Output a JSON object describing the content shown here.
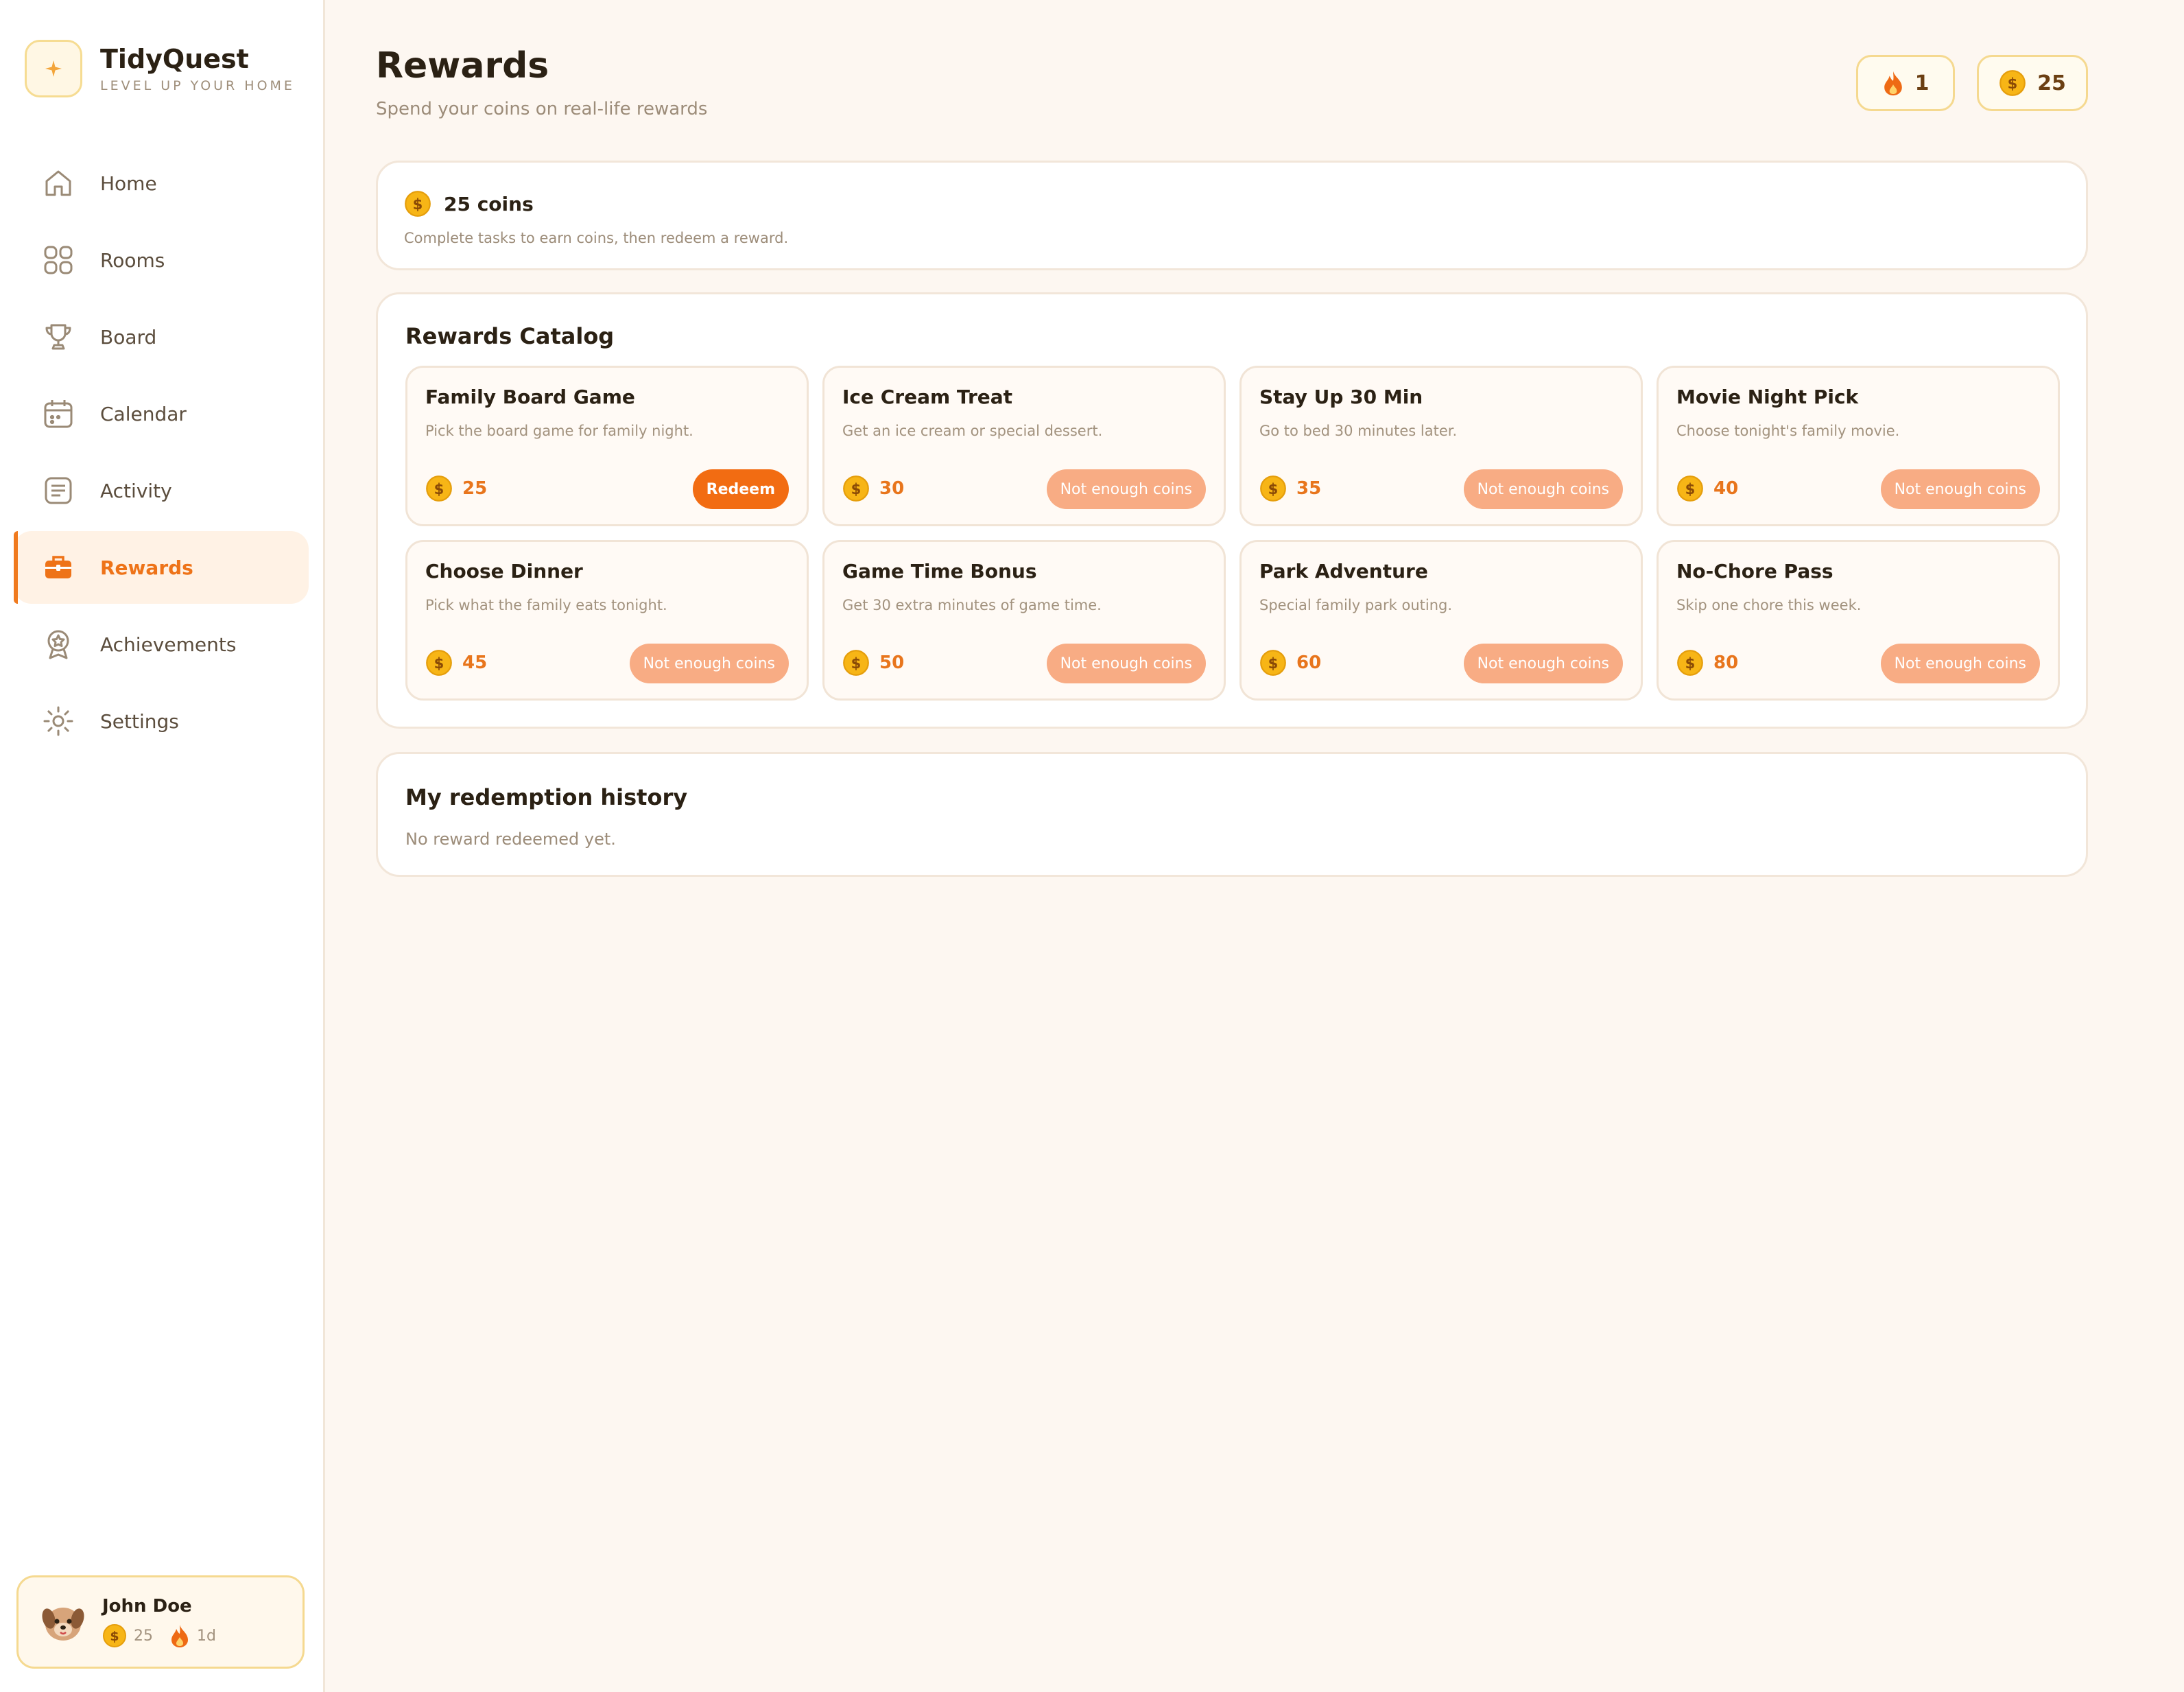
{
  "brand": {
    "title": "TidyQuest",
    "tagline": "LEVEL UP YOUR HOME"
  },
  "nav": {
    "items": [
      {
        "label": "Home",
        "icon": "home-icon"
      },
      {
        "label": "Rooms",
        "icon": "grid-icon"
      },
      {
        "label": "Board",
        "icon": "trophy-icon"
      },
      {
        "label": "Calendar",
        "icon": "calendar-icon"
      },
      {
        "label": "Activity",
        "icon": "list-icon"
      },
      {
        "label": "Rewards",
        "icon": "gift-box-icon",
        "active": true
      },
      {
        "label": "Achievements",
        "icon": "medal-icon"
      },
      {
        "label": "Settings",
        "icon": "gear-icon"
      }
    ]
  },
  "user": {
    "name": "John Doe",
    "coins": "25",
    "streak": "1d",
    "avatar": "dog-avatar"
  },
  "header": {
    "title": "Rewards",
    "subtitle": "Spend your coins on real-life rewards",
    "streak": "1",
    "coins": "25"
  },
  "balance": {
    "amount": "25 coins",
    "note": "Complete tasks to earn coins, then redeem a reward."
  },
  "catalog": {
    "title": "Rewards Catalog",
    "rewards": [
      {
        "title": "Family Board Game",
        "desc": "Pick the board game for family night.",
        "cost": "25",
        "button": "Redeem"
      },
      {
        "title": "Ice Cream Treat",
        "desc": "Get an ice cream or special dessert.",
        "cost": "30",
        "button": "Not enough coins"
      },
      {
        "title": "Stay Up 30 Min",
        "desc": "Go to bed 30 minutes later.",
        "cost": "35",
        "button": "Not enough coins"
      },
      {
        "title": "Movie Night Pick",
        "desc": "Choose tonight's family movie.",
        "cost": "40",
        "button": "Not enough coins"
      },
      {
        "title": "Choose Dinner",
        "desc": "Pick what the family eats tonight.",
        "cost": "45",
        "button": "Not enough coins"
      },
      {
        "title": "Game Time Bonus",
        "desc": "Get 30 extra minutes of game time.",
        "cost": "50",
        "button": "Not enough coins"
      },
      {
        "title": "Park Adventure",
        "desc": "Special family park outing.",
        "cost": "60",
        "button": "Not enough coins"
      },
      {
        "title": "No-Chore Pass",
        "desc": "Skip one chore this week.",
        "cost": "80",
        "button": "Not enough coins"
      }
    ]
  },
  "history": {
    "title": "My redemption history",
    "empty": "No reward redeemed yet."
  },
  "colors": {
    "accent": "#f26c12",
    "accent_muted": "#f8ac84",
    "coin": "#f7b516",
    "background": "#fdf7f1",
    "active_nav_bg": "#fff2e5"
  }
}
